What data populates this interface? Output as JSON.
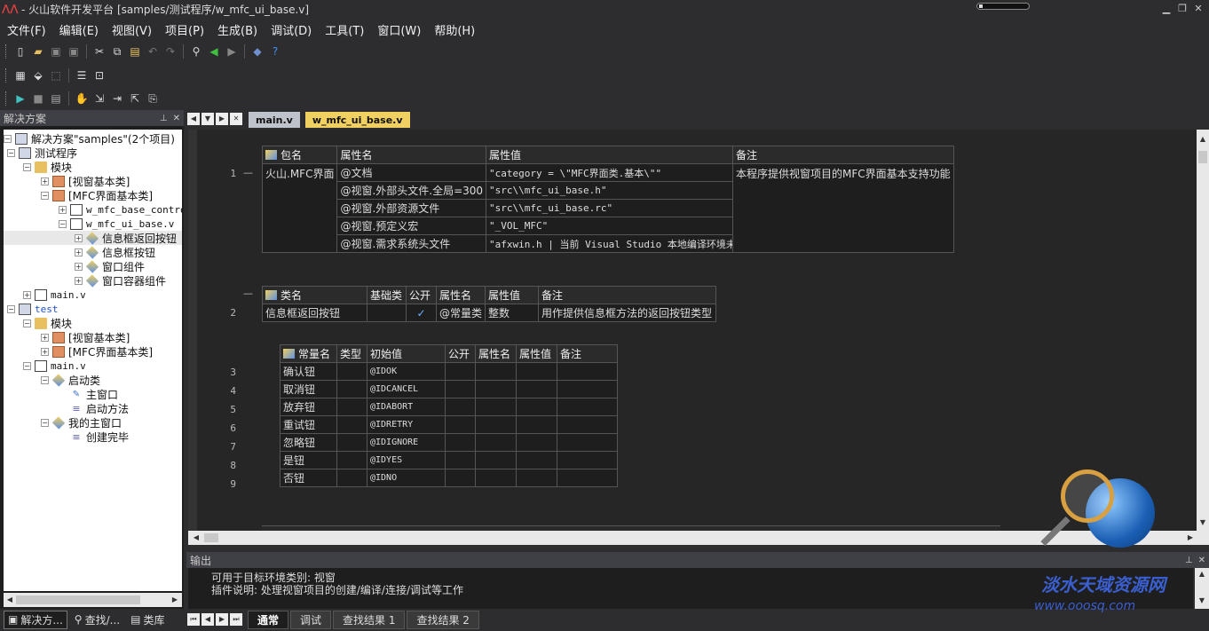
{
  "window": {
    "title": "- 火山软件开发平台 [samples/测试程序/w_mfc_ui_base.v]",
    "progress": 0.05
  },
  "menu": [
    "文件(F)",
    "编辑(E)",
    "视图(V)",
    "项目(P)",
    "生成(B)",
    "调试(D)",
    "工具(T)",
    "窗口(W)",
    "帮助(H)"
  ],
  "solution_panel": {
    "title": "解决方案",
    "tree": [
      {
        "label": "解决方案\"samples\"(2个项目)"
      },
      {
        "label": "测试程序"
      },
      {
        "label": "模块"
      },
      {
        "label": "[视窗基本类]"
      },
      {
        "label": "[MFC界面基本类]"
      },
      {
        "label": "w_mfc_base_contro"
      },
      {
        "label": "w_mfc_ui_base.v"
      },
      {
        "label": "信息框返回按钮"
      },
      {
        "label": "信息框按钮"
      },
      {
        "label": "窗口组件"
      },
      {
        "label": "窗口容器组件"
      },
      {
        "label": "main.v"
      },
      {
        "label": "test"
      },
      {
        "label": "模块"
      },
      {
        "label": "[视窗基本类]"
      },
      {
        "label": "[MFC界面基本类]"
      },
      {
        "label": "main.v"
      },
      {
        "label": "启动类"
      },
      {
        "label": "主窗口"
      },
      {
        "label": "启动方法"
      },
      {
        "label": "我的主窗口"
      },
      {
        "label": "创建完毕"
      }
    ],
    "bottom_tabs": [
      "解决方...",
      "查找/...",
      "类库"
    ]
  },
  "doc_tabs": [
    "main.v",
    "w_mfc_ui_base.v"
  ],
  "editor": {
    "pkg_table": {
      "headers": [
        "包名",
        "属性名",
        "属性值",
        "备注"
      ],
      "line": "1",
      "name": "火山.MFC界面",
      "rows": [
        {
          "attr": "@文档",
          "value": "\"category = \\\"MFC界面类.基本\\\"\""
        },
        {
          "attr": "@视窗.外部头文件.全局=300",
          "value": "\"src\\\\mfc_ui_base.h\""
        },
        {
          "attr": "@视窗.外部资源文件",
          "value": "\"src\\\\mfc_ui_base.rc\""
        },
        {
          "attr": "@视窗.预定义宏",
          "value": "\"_VOL_MFC\""
        },
        {
          "attr": "@视窗.需求系统头文件",
          "value": "\"afxwin.h | 当前 Visual Studio 本地编译环境未"
        }
      ],
      "remark": "本程序提供视窗项目的MFC界面基本支持功能"
    },
    "class_table": {
      "headers": [
        "类名",
        "基础类",
        "公开",
        "属性名",
        "属性值",
        "备注"
      ],
      "line": "2",
      "row": {
        "name": "信息框返回按钮",
        "base": "",
        "public": "✓",
        "attr": "@常量类",
        "value": "整数",
        "remark": "用作提供信息框方法的返回按钮类型"
      }
    },
    "const_table": {
      "headers": [
        "常量名",
        "类型",
        "初始值",
        "公开",
        "属性名",
        "属性值",
        "备注"
      ],
      "rows": [
        {
          "line": "3",
          "name": "确认钮",
          "init": "@IDOK"
        },
        {
          "line": "4",
          "name": "取消钮",
          "init": "@IDCANCEL"
        },
        {
          "line": "5",
          "name": "放弃钮",
          "init": "@IDABORT"
        },
        {
          "line": "6",
          "name": "重试钮",
          "init": "@IDRETRY"
        },
        {
          "line": "7",
          "name": "忽略钮",
          "init": "@IDIGNORE"
        },
        {
          "line": "8",
          "name": "是钮",
          "init": "@IDYES"
        },
        {
          "line": "9",
          "name": "否钮",
          "init": "@IDNO"
        }
      ]
    }
  },
  "output": {
    "title": "输出",
    "lines": [
      "可用于目标环境类别: 视窗",
      "插件说明: 处理视窗项目的创建/编译/连接/调试等工作"
    ],
    "tabs": [
      "通常",
      "调试",
      "查找结果 1",
      "查找结果 2"
    ]
  },
  "watermark": {
    "text": "淡水天域资源网",
    "url": "www.ooosq.com"
  },
  "colors": {
    "background": "#2d2d30",
    "editor_bg": "#1e1e1e",
    "active_tab": "#f0d060",
    "keyword": "#f0c000",
    "string": "#d070d0",
    "comment": "#60c040"
  }
}
